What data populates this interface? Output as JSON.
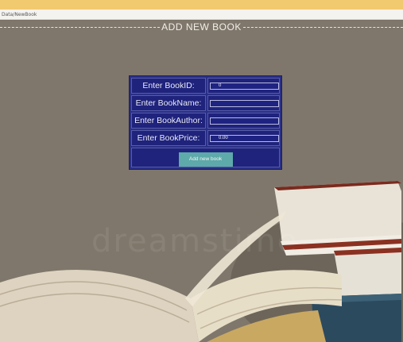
{
  "browser": {
    "url": "Data/NewBook"
  },
  "page": {
    "title": "ADD NEW BOOK"
  },
  "form": {
    "book_id_label": "Enter BookID:",
    "book_id_value": "0",
    "book_name_label": "Enter BookName:",
    "book_name_value": "",
    "book_author_label": "Enter BookAuthor:",
    "book_author_value": "",
    "book_price_label": "Enter BookPrice:",
    "book_price_value": "0.00",
    "submit_label": "Add new book"
  },
  "background": {
    "watermark": "dreamstime"
  },
  "colors": {
    "top_bar": "#f1c96e",
    "form_background": "#1f237c",
    "button": "#5ea9a9"
  }
}
